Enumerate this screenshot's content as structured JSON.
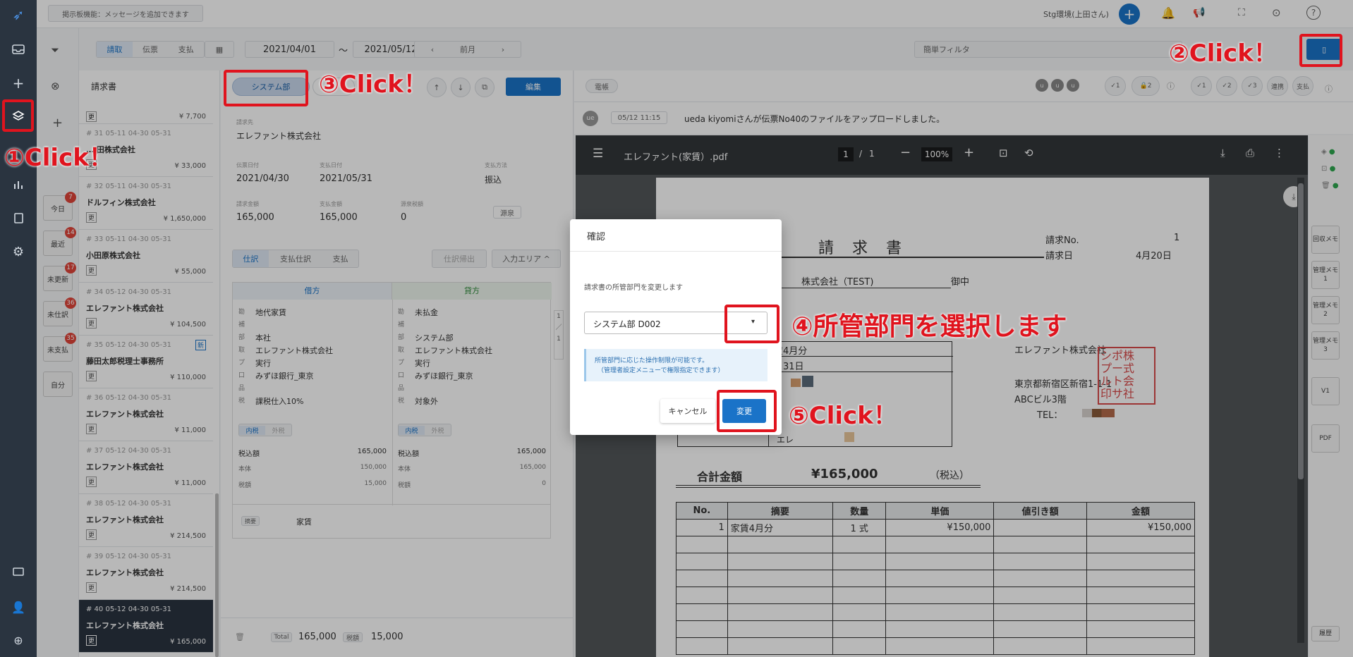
{
  "topbar": {
    "notice": "掲示板機能：メッセージを追加できます",
    "user": "Stg環境(上田さん)"
  },
  "toolbar": {
    "tabs": [
      "請取",
      "伝票",
      "支払"
    ],
    "date_from": "2021/04/01",
    "tilde": "～",
    "date_to": "2021/05/12",
    "prev": "前月",
    "filter_placeholder": "簡単フィルタ"
  },
  "list": {
    "title": "請求書",
    "top_amount": "¥ 7,700",
    "tag": "更",
    "items": [
      {
        "meta": "# 31  05-11  04-30  05-31",
        "name": "… 田株式会社",
        "amount": "¥ 33,000"
      },
      {
        "meta": "# 32  05-11  04-30  05-31",
        "name": "ドルフィン株式会社",
        "amount": "¥ 1,650,000"
      },
      {
        "meta": "# 33  05-11  04-30  05-31",
        "name": "小田原株式会社",
        "amount": "¥ 55,000"
      },
      {
        "meta": "# 34  05-12  04-30  05-31",
        "name": "エレファント株式会社",
        "amount": "¥ 104,500"
      },
      {
        "meta": "# 35  05-12  04-30  05-31",
        "name": "藤田太郎税理士事務所",
        "amount": "¥ 110,000",
        "new": "新"
      },
      {
        "meta": "# 36  05-12  04-30  05-31",
        "name": "エレファント株式会社",
        "amount": "¥ 11,000"
      },
      {
        "meta": "# 37  05-12  04-30  05-31",
        "name": "エレファント株式会社",
        "amount": "¥ 11,000"
      },
      {
        "meta": "# 38  05-12  04-30  05-31",
        "name": "エレファント株式会社",
        "amount": "¥ 214,500"
      },
      {
        "meta": "# 39  05-12  04-30  05-31",
        "name": "エレファント株式会社",
        "amount": "¥ 214,500"
      },
      {
        "meta": "# 40  05-12  04-30  05-31",
        "name": "エレファント株式会社",
        "amount": "¥ 165,000"
      }
    ]
  },
  "chips": [
    {
      "label": "今日",
      "badge": "7"
    },
    {
      "label": "最近",
      "badge": "14"
    },
    {
      "label": "未更新",
      "badge": "17"
    },
    {
      "label": "未仕訳",
      "badge": "36"
    },
    {
      "label": "未支払",
      "badge": "35"
    },
    {
      "label": "自分",
      "badge": ""
    }
  ],
  "detail": {
    "dept_button": "システム部",
    "edit_button": "編集",
    "vendor_label": "請求先",
    "vendor": "エレファント株式会社",
    "f1_label": "伝票日付",
    "f1": "2021/04/30",
    "f2_label": "支払日付",
    "f2": "2021/05/31",
    "f3_label": "支払方法",
    "f3": "振込",
    "f4_label": "請求金額",
    "f4": "165,000",
    "f5_label": "支払金額",
    "f5": "165,000",
    "f6_label": "源泉税額",
    "f6": "0",
    "gensen_button": "源泉",
    "tabs": [
      "仕訳",
      "支払仕訳",
      "支払"
    ],
    "shiwake_button": "仕訳帰出",
    "area_button": "入力エリア ^",
    "debit": "借方",
    "credit": "貸方",
    "dlines": [
      [
        "勘",
        "地代家賃"
      ],
      [
        "補",
        ""
      ],
      [
        "部",
        "本社"
      ],
      [
        "取",
        "エレファント株式会社"
      ],
      [
        "プ",
        "実行"
      ],
      [
        "口",
        "みずほ銀行_東京"
      ],
      [
        "品",
        ""
      ],
      [
        "税",
        "課税仕入10%"
      ]
    ],
    "clines": [
      [
        "勘",
        "未払金"
      ],
      [
        "補",
        ""
      ],
      [
        "部",
        "システム部"
      ],
      [
        "取",
        "エレファント株式会社"
      ],
      [
        "プ",
        "実行"
      ],
      [
        "口",
        "みずほ銀行_東京"
      ],
      [
        "品",
        ""
      ],
      [
        "税",
        "対象外"
      ]
    ],
    "tax_in": "内税",
    "tax_out": "外税",
    "sum": [
      [
        "税込額",
        "165,000",
        "165,000"
      ],
      [
        "本体",
        "150,000",
        "165,000"
      ],
      [
        "税額",
        "15,000",
        "0"
      ]
    ],
    "memo_label": "摘要",
    "memo": "家賃",
    "total_label": "Total",
    "total": "165,000",
    "tax_label": "税額",
    "tax": "15,000"
  },
  "chat": {
    "tag": "電帳",
    "avatar": "ue",
    "time": "05/12 11:15",
    "message": "ueda kiyomiさんが伝票No40のファイルをアップロードしました。",
    "right_chips": [
      "1",
      "2",
      "1",
      "2",
      "3"
    ],
    "link": "連携",
    "pay": "支払"
  },
  "pdf": {
    "filename": "エレファント(家賃）.pdf",
    "page": "1",
    "pages": "1",
    "sep": "/",
    "zoom": "100%"
  },
  "paper": {
    "title": "請　求　書",
    "no_label": "請求No.",
    "no": "1",
    "date_label": "請求日",
    "date": "4月20日",
    "to": "株式会社（TEST)",
    "onchu": "御中",
    "issuer": "エレファント株式会社",
    "addr": "東京都新宿区新宿1-1-1",
    "bldg": "ABCビル3階",
    "tel": "TEL：",
    "row1": "賃4月分",
    "row2": "月31日",
    "row5": "エレ",
    "total_label": "合計金額",
    "total": "¥165,000",
    "tax_note": "（税込）",
    "cols": [
      "No.",
      "摘要",
      "数量",
      "単価",
      "値引き額",
      "金額"
    ],
    "line": [
      "1",
      "家賃4月分",
      "1 式",
      "¥150,000",
      "",
      "¥150,000"
    ],
    "stamp": "シポ株\nプー式\nルト会\n印サ社"
  },
  "rightbar": [
    "回収メモ",
    "管理メモ1",
    "管理メモ2",
    "管理メモ3",
    "V1",
    "PDF",
    "履歴"
  ],
  "modal": {
    "title": "確認",
    "text": "請求書の所管部門を変更します",
    "select": "システム部 D002",
    "info1": "所管部門に応じた操作制限が可能です。",
    "info2": "（管理者設定メニューで権限指定できます）",
    "cancel": "キャンセル",
    "ok": "変更"
  },
  "annotations": {
    "a1": "①Click！",
    "a2": "②Click！",
    "a3": "③Click！",
    "a4": "④所管部門を選択します",
    "a5": "⑤Click！"
  },
  "colors": {
    "accent": "#1a73c8",
    "annotation": "#e0141e",
    "rail": "#2a3440"
  }
}
